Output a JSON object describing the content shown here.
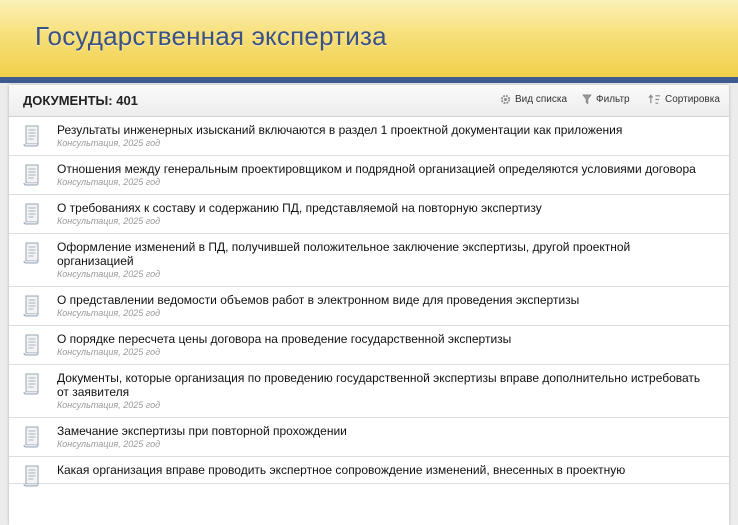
{
  "header": {
    "title": "Государственная экспертиза"
  },
  "toolbar": {
    "documents_label": "ДОКУМЕНТЫ: 401",
    "view_label": "Вид списка",
    "filter_label": "Фильтр",
    "sort_label": "Сортировка",
    "icons": {
      "view": "gear-icon",
      "filter": "funnel-icon",
      "sort": "sort-icon"
    }
  },
  "documents": [
    {
      "title": "Результаты инженерных изысканий включаются в раздел 1 проектной документации как приложения",
      "meta": "Консультация, 2025 год"
    },
    {
      "title": "Отношения между генеральным проектировщиком и подрядной организацией определяются условиями договора",
      "meta": "Консультация, 2025 год"
    },
    {
      "title": "О требованиях к составу и содержанию ПД, представляемой на повторную экспертизу",
      "meta": "Консультация, 2025 год"
    },
    {
      "title": "Оформление изменений в ПД, получившей положительное заключение экспертизы, другой проектной организацией",
      "meta": "Консультация, 2025 год"
    },
    {
      "title": "О представлении ведомости объемов работ в электронном виде для проведения экспертизы",
      "meta": "Консультация, 2025 год"
    },
    {
      "title": "О порядке пересчета цены договора на проведение государственной экспертизы",
      "meta": "Консультация, 2025 год"
    },
    {
      "title": "Документы, которые организация по проведению государственной экспертизы вправе дополнительно истребовать от заявителя",
      "meta": "Консультация, 2025 год"
    },
    {
      "title": "Замечание экспертизы при повторной прохождении",
      "meta": "Консультация, 2025 год"
    },
    {
      "title": "Какая организация вправе проводить экспертное сопровождение изменений, внесенных в проектную",
      "meta": ""
    }
  ],
  "colors": {
    "accent": "#3e5a8e",
    "title_text": "#3c5282",
    "header_yellow": "#f0cf4a"
  }
}
